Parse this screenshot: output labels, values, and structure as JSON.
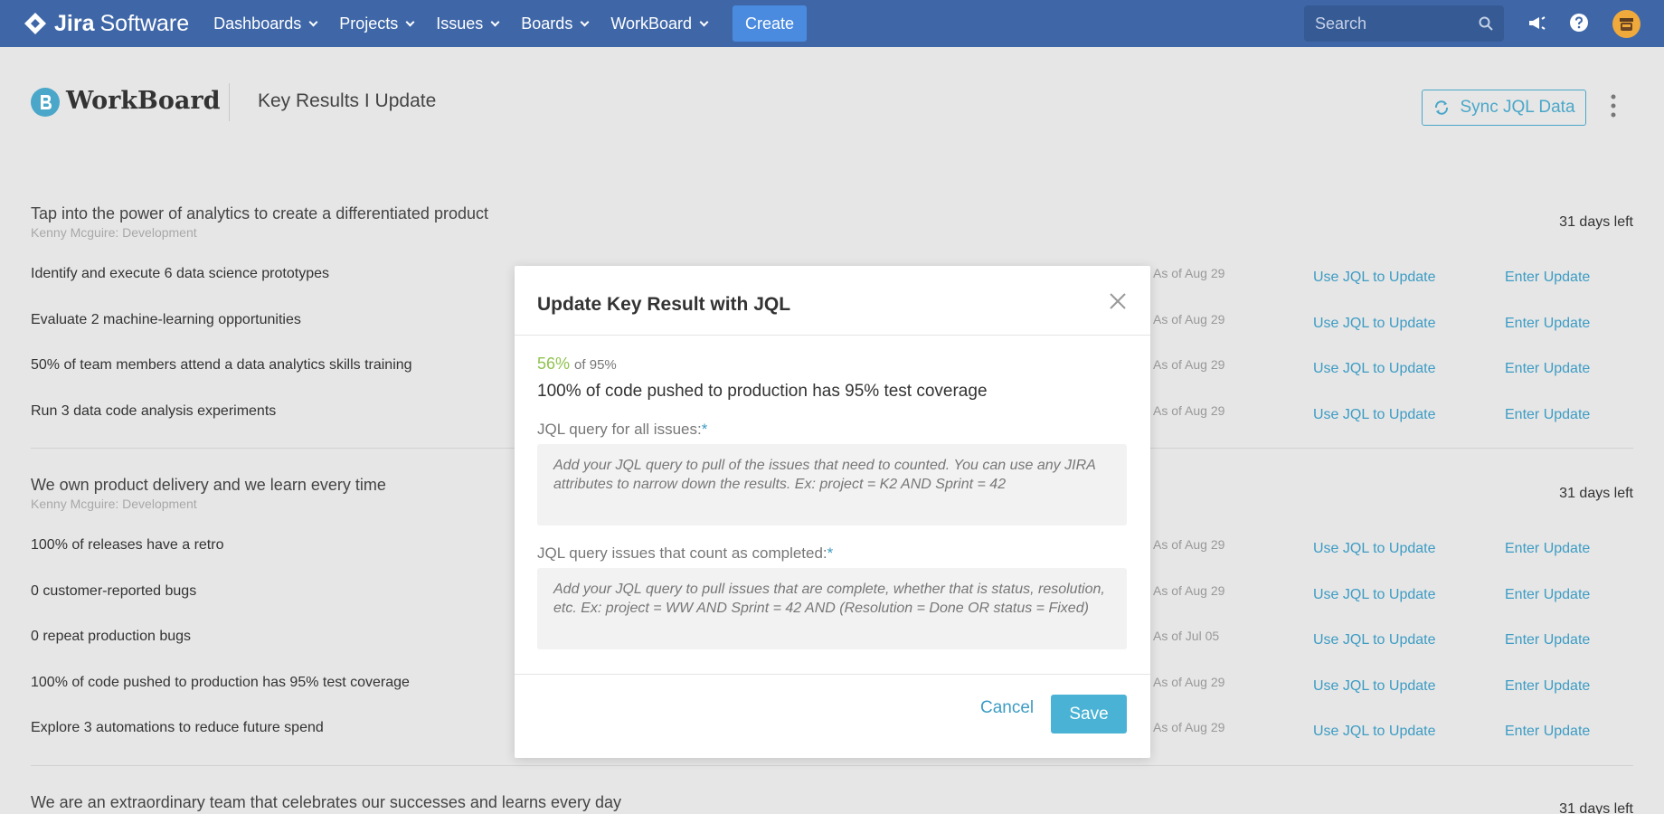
{
  "topnav": {
    "brand_bold": "Jira",
    "brand_rest": "Software",
    "items": [
      {
        "label": "Dashboards"
      },
      {
        "label": "Projects"
      },
      {
        "label": "Issues"
      },
      {
        "label": "Boards"
      },
      {
        "label": "WorkBoard"
      }
    ],
    "create_label": "Create",
    "search_placeholder": "Search"
  },
  "header": {
    "app_name": "WorkBoard",
    "page_title": "Key Results I Update",
    "sync_label": "Sync JQL Data"
  },
  "objectives": [
    {
      "title": "Tap into the power of analytics to create a differentiated product",
      "owner": "Kenny Mcguire: Development",
      "days_left": "31 days left",
      "key_results": [
        {
          "text": "Identify and execute 6 data science prototypes",
          "as_of": "As of Aug 29"
        },
        {
          "text": "Evaluate 2 machine-learning opportunities",
          "as_of": "As of Aug 29"
        },
        {
          "text": "50% of team members attend a data analytics skills training",
          "as_of": "As of Aug 29"
        },
        {
          "text": "Run 3 data code analysis experiments",
          "as_of": "As of Aug 29"
        }
      ]
    },
    {
      "title": "We own product delivery and we learn every time",
      "owner": "Kenny Mcguire: Development",
      "days_left": "31 days left",
      "key_results": [
        {
          "text": "100% of releases have a retro",
          "as_of": "As of Aug 29"
        },
        {
          "text": "0 customer-reported bugs",
          "as_of": "As of Aug 29"
        },
        {
          "text": "0 repeat production bugs",
          "as_of": "As of Jul 05"
        },
        {
          "text": "100% of code pushed to production has 95% test coverage",
          "as_of": "As of Aug 29"
        },
        {
          "text": "Explore 3 automations to reduce future spend",
          "as_of": "As of Aug 29"
        }
      ]
    },
    {
      "title": "We are an extraordinary team that celebrates our successes and learns every day",
      "days_left": "31 days left"
    }
  ],
  "row_actions": {
    "jql_label": "Use JQL to Update",
    "enter_label": "Enter Update"
  },
  "modal": {
    "title": "Update Key Result with JQL",
    "progress_value": "56%",
    "progress_target": "of 95%",
    "key_result": "100% of code pushed to production has 95% test coverage",
    "field1_label": "JQL query for all issues:",
    "field1_placeholder": "Add your JQL query to pull of the issues that need to counted. You can use any JIRA attributes to narrow down the results. Ex: project = K2 AND Sprint = 42",
    "field2_label": "JQL query issues that count as completed:",
    "field2_placeholder": "Add your JQL query to pull issues that are complete, whether that is status, resolution, etc. Ex: project = WW AND Sprint = 42 AND (Resolution = Done OR status = Fixed)",
    "required_mark": "*",
    "cancel_label": "Cancel",
    "save_label": "Save"
  },
  "colors": {
    "nav_bg": "#3f67a8",
    "accent": "#3d9cc4",
    "progress_green": "#8fc350",
    "save_bg": "#4ab3d5"
  }
}
